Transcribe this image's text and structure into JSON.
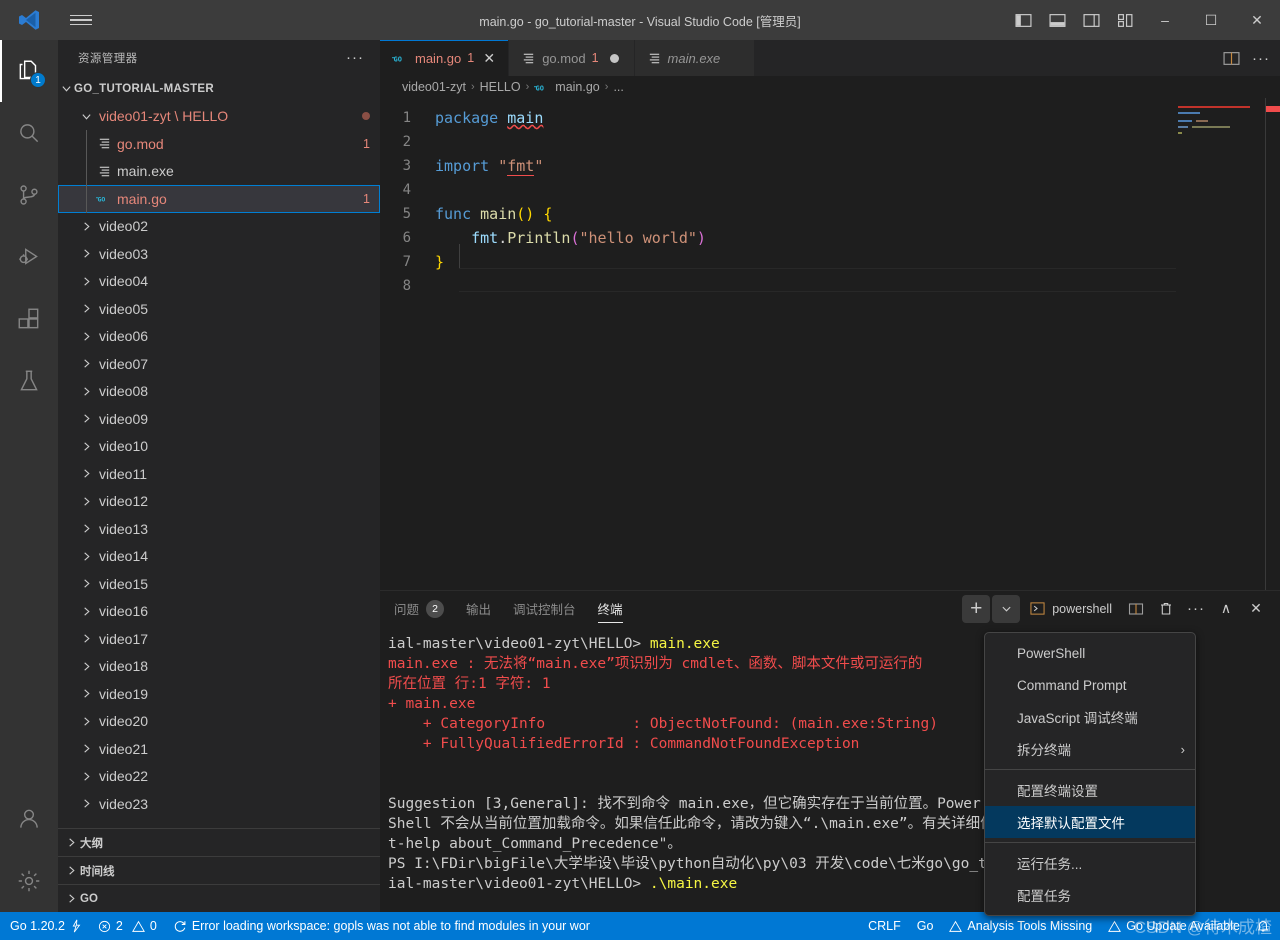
{
  "titlebar": {
    "title": "main.go - go_tutorial-master - Visual Studio Code [管理员]",
    "hamburger": "menu-icon",
    "layout_icons": [
      "toggle-primary-sidebar",
      "toggle-panel",
      "toggle-secondary-sidebar",
      "customize-layout"
    ],
    "minimize": "–",
    "maximize": "☐",
    "close": "✕"
  },
  "activitybar": {
    "items": [
      {
        "name": "explorer",
        "icon": "files-icon",
        "badge": "1",
        "active": true
      },
      {
        "name": "search",
        "icon": "search-icon",
        "badge": "",
        "active": false
      },
      {
        "name": "source-control",
        "icon": "source-control-icon",
        "badge": "",
        "active": false
      },
      {
        "name": "run-and-debug",
        "icon": "run-debug-icon",
        "badge": "",
        "active": false
      },
      {
        "name": "extensions",
        "icon": "extensions-icon",
        "badge": "",
        "active": false
      },
      {
        "name": "testing",
        "icon": "beaker-icon",
        "badge": "",
        "active": false
      }
    ],
    "bottom": [
      {
        "name": "accounts",
        "icon": "account-icon"
      },
      {
        "name": "manage",
        "icon": "gear-icon"
      }
    ]
  },
  "sidebar": {
    "header_title": "资源管理器",
    "header_actions": "···",
    "root": "GO_TUTORIAL-MASTER",
    "tree": [
      {
        "label": "video01-zyt \\ HELLO",
        "type": "folder-open",
        "depth": 1,
        "error": true,
        "badge": "",
        "dot": true
      },
      {
        "label": "go.mod",
        "type": "file-mod",
        "depth": 2,
        "error": true,
        "badge": "1",
        "dot": false
      },
      {
        "label": "main.exe",
        "type": "file-exe",
        "depth": 2,
        "error": false,
        "badge": "",
        "dot": false
      },
      {
        "label": "main.go",
        "type": "file-go",
        "depth": 2,
        "error": true,
        "badge": "1",
        "dot": false,
        "selected": true
      },
      {
        "label": "video02",
        "type": "folder",
        "depth": 1,
        "error": false,
        "badge": "",
        "dot": false
      },
      {
        "label": "video03",
        "type": "folder",
        "depth": 1,
        "error": false,
        "badge": "",
        "dot": false
      },
      {
        "label": "video04",
        "type": "folder",
        "depth": 1,
        "error": false,
        "badge": "",
        "dot": false
      },
      {
        "label": "video05",
        "type": "folder",
        "depth": 1,
        "error": false,
        "badge": "",
        "dot": false
      },
      {
        "label": "video06",
        "type": "folder",
        "depth": 1,
        "error": false,
        "badge": "",
        "dot": false
      },
      {
        "label": "video07",
        "type": "folder",
        "depth": 1,
        "error": false,
        "badge": "",
        "dot": false
      },
      {
        "label": "video08",
        "type": "folder",
        "depth": 1,
        "error": false,
        "badge": "",
        "dot": false
      },
      {
        "label": "video09",
        "type": "folder",
        "depth": 1,
        "error": false,
        "badge": "",
        "dot": false
      },
      {
        "label": "video10",
        "type": "folder",
        "depth": 1,
        "error": false,
        "badge": "",
        "dot": false
      },
      {
        "label": "video11",
        "type": "folder",
        "depth": 1,
        "error": false,
        "badge": "",
        "dot": false
      },
      {
        "label": "video12",
        "type": "folder",
        "depth": 1,
        "error": false,
        "badge": "",
        "dot": false
      },
      {
        "label": "video13",
        "type": "folder",
        "depth": 1,
        "error": false,
        "badge": "",
        "dot": false
      },
      {
        "label": "video14",
        "type": "folder",
        "depth": 1,
        "error": false,
        "badge": "",
        "dot": false
      },
      {
        "label": "video15",
        "type": "folder",
        "depth": 1,
        "error": false,
        "badge": "",
        "dot": false
      },
      {
        "label": "video16",
        "type": "folder",
        "depth": 1,
        "error": false,
        "badge": "",
        "dot": false
      },
      {
        "label": "video17",
        "type": "folder",
        "depth": 1,
        "error": false,
        "badge": "",
        "dot": false
      },
      {
        "label": "video18",
        "type": "folder",
        "depth": 1,
        "error": false,
        "badge": "",
        "dot": false
      },
      {
        "label": "video19",
        "type": "folder",
        "depth": 1,
        "error": false,
        "badge": "",
        "dot": false
      },
      {
        "label": "video20",
        "type": "folder",
        "depth": 1,
        "error": false,
        "badge": "",
        "dot": false
      },
      {
        "label": "video21",
        "type": "folder",
        "depth": 1,
        "error": false,
        "badge": "",
        "dot": false
      },
      {
        "label": "video22",
        "type": "folder",
        "depth": 1,
        "error": false,
        "badge": "",
        "dot": false
      },
      {
        "label": "video23",
        "type": "folder",
        "depth": 1,
        "error": false,
        "badge": "",
        "dot": false
      }
    ],
    "sections": [
      {
        "label": "大纲"
      },
      {
        "label": "时间线"
      },
      {
        "label": "GO"
      }
    ]
  },
  "editor": {
    "tabs": [
      {
        "label": "main.go",
        "icon": "go-file-icon",
        "badge": "1",
        "active": true,
        "dirty": false,
        "closeable": true,
        "italic": false
      },
      {
        "label": "go.mod",
        "icon": "mod-file-icon",
        "badge": "1",
        "active": false,
        "dirty": true,
        "closeable": false,
        "italic": false
      },
      {
        "label": "main.exe",
        "icon": "exe-file-icon",
        "badge": "",
        "active": false,
        "dirty": false,
        "closeable": false,
        "italic": true
      }
    ],
    "tab_actions": [
      {
        "name": "split-editor-right-icon"
      },
      {
        "name": "more-actions-icon",
        "glyph": "···"
      }
    ],
    "breadcrumbs": [
      "video01-zyt",
      "HELLO",
      "main.go",
      "..."
    ],
    "lines": [
      {
        "n": 1,
        "tokens": [
          {
            "t": "package ",
            "c": "kw"
          },
          {
            "t": "main",
            "c": "ident squiggle"
          }
        ]
      },
      {
        "n": 2,
        "tokens": []
      },
      {
        "n": 3,
        "tokens": [
          {
            "t": "import ",
            "c": "kw"
          },
          {
            "t": "\"",
            "c": "str"
          },
          {
            "t": "fmt",
            "c": "str underline-err"
          },
          {
            "t": "\"",
            "c": "str"
          }
        ]
      },
      {
        "n": 4,
        "tokens": []
      },
      {
        "n": 5,
        "tokens": [
          {
            "t": "func ",
            "c": "kw"
          },
          {
            "t": "main",
            "c": "fn"
          },
          {
            "t": "()",
            "c": "punct-y"
          },
          {
            "t": " ",
            "c": ""
          },
          {
            "t": "{",
            "c": "punct-y"
          }
        ]
      },
      {
        "n": 6,
        "tokens": [
          {
            "t": "    ",
            "c": ""
          },
          {
            "t": "fmt",
            "c": "ident"
          },
          {
            "t": ".",
            "c": "ctext"
          },
          {
            "t": "Println",
            "c": "fn"
          },
          {
            "t": "(",
            "c": "punct-p"
          },
          {
            "t": "\"hello world\"",
            "c": "str"
          },
          {
            "t": ")",
            "c": "punct-p"
          }
        ]
      },
      {
        "n": 7,
        "tokens": [
          {
            "t": "}",
            "c": "punct-y"
          }
        ]
      },
      {
        "n": 8,
        "tokens": []
      }
    ]
  },
  "panel": {
    "tabs": [
      {
        "label": "问题",
        "badge": "2",
        "active": false
      },
      {
        "label": "输出",
        "badge": "",
        "active": false
      },
      {
        "label": "调试控制台",
        "badge": "",
        "active": false
      },
      {
        "label": "终端",
        "badge": "",
        "active": true
      }
    ],
    "new_terminal": "+",
    "new_terminal_chevron": "⌄",
    "shell_name": "powershell",
    "actions": [
      {
        "name": "split-terminal-icon"
      },
      {
        "name": "kill-terminal-icon"
      },
      {
        "name": "terminal-more-icon",
        "glyph": "···"
      },
      {
        "name": "maximize-panel-icon",
        "glyph": "∧"
      },
      {
        "name": "close-panel-icon",
        "glyph": "✕"
      }
    ],
    "terminal_lines": [
      [
        {
          "t": "ial-master\\video01-zyt\\HELLO> ",
          "c": "t-white"
        },
        {
          "t": "main.exe",
          "c": "t-yellow"
        }
      ],
      [
        {
          "t": "main.exe : 无法将“main.exe”项识别为 cmdlet、函数、脚本文件或可运行的",
          "c": "t-red"
        }
      ],
      [
        {
          "t": "所在位置 行:1 字符: 1",
          "c": "t-red"
        }
      ],
      [
        {
          "t": "+ main.exe",
          "c": "t-red"
        }
      ],
      [
        {
          "t": "    + CategoryInfo          : ObjectNotFound: (main.exe:String) ",
          "c": "t-red"
        }
      ],
      [
        {
          "t": "    + FullyQualifiedErrorId : CommandNotFoundException",
          "c": "t-red"
        }
      ],
      [
        {
          "t": "",
          "c": "t-white"
        }
      ],
      [
        {
          "t": "",
          "c": "t-white"
        }
      ],
      [
        {
          "t": "Suggestion [3,General]: 找不到命令 main.exe，但它确实存在于当前位置。Power",
          "c": "t-white"
        }
      ],
      [
        {
          "t": "Shell 不会从当前位置加载命令。如果信任此命令，请改为键入“.\\main.exe”。有关详细信息，请参阅 \"ge",
          "c": "t-white"
        }
      ],
      [
        {
          "t": "t-help about_Command_Precedence\"。",
          "c": "t-white"
        }
      ],
      [
        {
          "t": "PS I:\\FDir\\bigFile\\大学毕设\\毕设\\python自动化\\py\\03 开发\\code\\七米go\\go_tutor",
          "c": "t-white"
        }
      ],
      [
        {
          "t": "ial-master\\video01-zyt\\HELLO> ",
          "c": "t-white"
        },
        {
          "t": ".\\main.exe",
          "c": "t-yellow"
        }
      ]
    ]
  },
  "context_menu": {
    "items": [
      {
        "label": "PowerShell",
        "submenu": false,
        "selected": false
      },
      {
        "label": "Command Prompt",
        "submenu": false,
        "selected": false
      },
      {
        "label": "JavaScript 调试终端",
        "submenu": false,
        "selected": false
      },
      {
        "label": "拆分终端",
        "submenu": true,
        "selected": false,
        "sub_glyph": "›"
      },
      {
        "sep": true
      },
      {
        "label": "配置终端设置",
        "submenu": false,
        "selected": false
      },
      {
        "label": "选择默认配置文件",
        "submenu": false,
        "selected": true
      },
      {
        "sep": true
      },
      {
        "label": "运行任务...",
        "submenu": false,
        "selected": false
      },
      {
        "label": "配置任务",
        "submenu": false,
        "selected": false
      }
    ]
  },
  "statusbar": {
    "left": [
      {
        "name": "go-version",
        "label": "Go 1.20.2",
        "icon": "lightning-icon"
      },
      {
        "name": "problems",
        "label": "2",
        "label2": "0",
        "icon": "error-icon",
        "icon2": "warning-icon"
      },
      {
        "name": "workspace-error",
        "label": "Error loading workspace: gopls was not able to find modules in your wor",
        "icon": "sync-icon"
      }
    ],
    "right": [
      {
        "name": "eol",
        "label": "CRLF"
      },
      {
        "name": "language-mode",
        "label": "Go"
      },
      {
        "name": "analysis-tools",
        "label": "Analysis Tools Missing",
        "icon": "warning-icon"
      },
      {
        "name": "go-update",
        "label": "Go Update Available",
        "icon": "warning-icon"
      },
      {
        "name": "notifications",
        "label": "",
        "icon": "bell-icon"
      }
    ]
  },
  "watermark": "CSDN @待木成楂",
  "colors": {
    "accent": "#0078d4",
    "titlebar_bg": "#3c3c3c",
    "sidebar_bg": "#252526",
    "editor_bg": "#1e1e1e",
    "activitybar_bg": "#333333",
    "error_red": "#f14c4c",
    "selection_blue": "#04395e",
    "file_error": "#e6877a"
  }
}
